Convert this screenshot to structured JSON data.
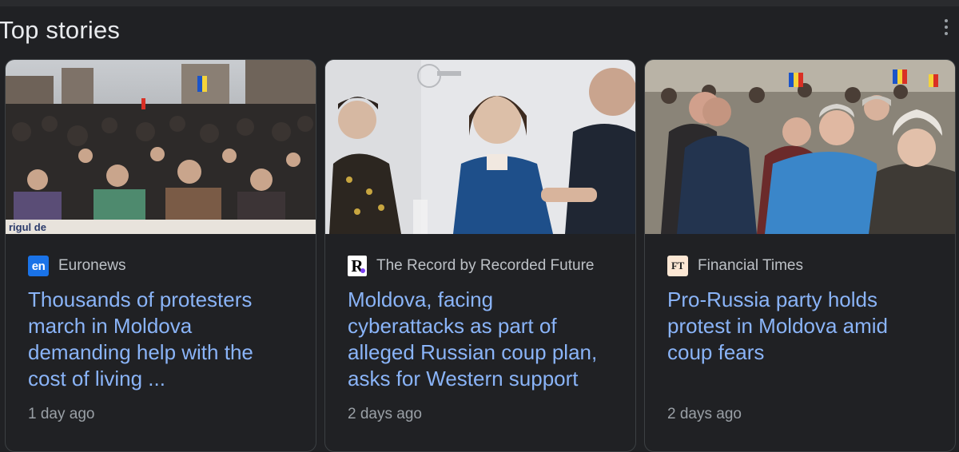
{
  "header": {
    "title": "Top stories"
  },
  "icons": {
    "more": "more-vert-icon"
  },
  "colors": {
    "background": "#202124",
    "headline": "#8ab4f8",
    "meta": "#9aa0a6"
  },
  "stories": [
    {
      "source": "Euronews",
      "favicon_text": "en",
      "headline": "Thousands of protesters march in Moldova demanding help with the cost of living ...",
      "time": "1 day ago",
      "image_banner_text": "rigul de"
    },
    {
      "source": "The Record by Recorded Future",
      "favicon_text": "R.",
      "headline": "Moldova, facing cyberattacks as part of alleged Russian coup plan, asks for Western support",
      "time": "2 days ago"
    },
    {
      "source": "Financial Times",
      "favicon_text": "FT",
      "headline": "Pro-Russia party holds protest in Moldova amid coup fears",
      "time": "2 days ago"
    }
  ]
}
